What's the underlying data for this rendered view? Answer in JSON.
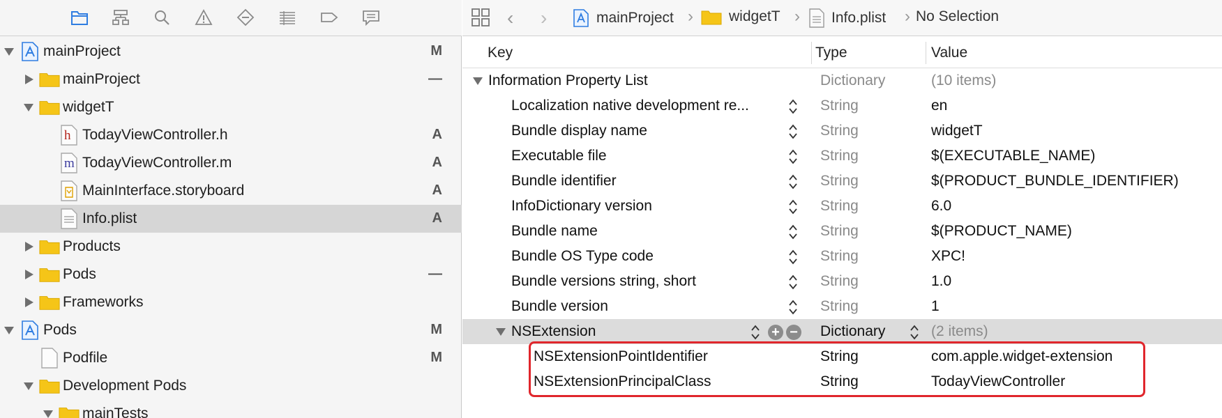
{
  "navigator": {
    "toolbar_icons": [
      "folder-icon",
      "hierarchy-icon",
      "search-icon",
      "warning-icon",
      "test-diamond-icon",
      "list-icon",
      "tag-icon",
      "comment-icon"
    ],
    "items": [
      {
        "label": "mainProject",
        "status": "M",
        "icon": "project-icon",
        "disclosure": "open"
      },
      {
        "label": "mainProject",
        "status": "—",
        "icon": "folder-icon",
        "disclosure": "closed"
      },
      {
        "label": "widgetT",
        "status": "",
        "icon": "folder-icon",
        "disclosure": "open"
      },
      {
        "label": "TodayViewController.h",
        "status": "A",
        "icon": "header-file-icon",
        "glyph": "h"
      },
      {
        "label": "TodayViewController.m",
        "status": "A",
        "icon": "implementation-file-icon",
        "glyph": "m"
      },
      {
        "label": "MainInterface.storyboard",
        "status": "A",
        "icon": "storyboard-file-icon"
      },
      {
        "label": "Info.plist",
        "status": "A",
        "icon": "plist-file-icon",
        "selected": true
      },
      {
        "label": "Products",
        "status": "",
        "icon": "folder-icon",
        "disclosure": "closed"
      },
      {
        "label": "Pods",
        "status": "—",
        "icon": "folder-icon",
        "disclosure": "closed"
      },
      {
        "label": "Frameworks",
        "status": "",
        "icon": "folder-icon",
        "disclosure": "closed"
      },
      {
        "label": "Pods",
        "status": "M",
        "icon": "project-icon",
        "disclosure": "open"
      },
      {
        "label": "Podfile",
        "status": "M",
        "icon": "file-icon"
      },
      {
        "label": "Development Pods",
        "status": "",
        "icon": "folder-icon",
        "disclosure": "open"
      },
      {
        "label": "mainTests",
        "status": "",
        "icon": "folder-icon",
        "disclosure": "open"
      }
    ]
  },
  "jumpbar": {
    "crumbs": [
      "mainProject",
      "widgetT",
      "Info.plist",
      "No Selection"
    ]
  },
  "plist": {
    "headers": {
      "key": "Key",
      "type": "Type",
      "value": "Value"
    },
    "root": {
      "key": "Information Property List",
      "type": "Dictionary",
      "value": "(10 items)"
    },
    "rows": [
      {
        "key": "Localization native development re...",
        "type": "String",
        "value": "en"
      },
      {
        "key": "Bundle display name",
        "type": "String",
        "value": "widgetT"
      },
      {
        "key": "Executable file",
        "type": "String",
        "value": "$(EXECUTABLE_NAME)"
      },
      {
        "key": "Bundle identifier",
        "type": "String",
        "value": "$(PRODUCT_BUNDLE_IDENTIFIER)"
      },
      {
        "key": "InfoDictionary version",
        "type": "String",
        "value": "6.0"
      },
      {
        "key": "Bundle name",
        "type": "String",
        "value": "$(PRODUCT_NAME)"
      },
      {
        "key": "Bundle OS Type code",
        "type": "String",
        "value": "XPC!"
      },
      {
        "key": "Bundle versions string, short",
        "type": "String",
        "value": "1.0"
      },
      {
        "key": "Bundle version",
        "type": "String",
        "value": "1"
      }
    ],
    "extension": {
      "key": "NSExtension",
      "type": "Dictionary",
      "value": "(2 items)",
      "add_label": "+",
      "remove_label": "−"
    },
    "children": [
      {
        "key": "NSExtensionPointIdentifier",
        "type": "String",
        "value": "com.apple.widget-extension"
      },
      {
        "key": "NSExtensionPrincipalClass",
        "type": "String",
        "value": "TodayViewController"
      }
    ]
  },
  "colors": {
    "highlight": "#e0262c",
    "folder": "#f5c518",
    "project": "#2f7de1"
  }
}
